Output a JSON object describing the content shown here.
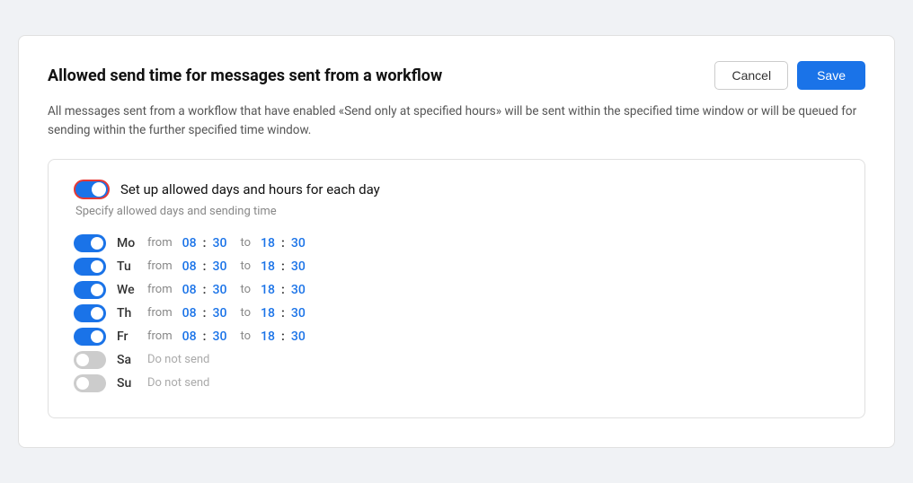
{
  "header": {
    "title": "Allowed send time for messages sent from a workflow",
    "cancel_label": "Cancel",
    "save_label": "Save"
  },
  "description": "All messages sent from a workflow that have enabled «Send only at specified hours» will be sent within the specified time window or will be queued for sending within the further specified time window.",
  "card": {
    "main_toggle_label": "Set up allowed days and hours for each day",
    "sub_label": "Specify allowed days and sending time",
    "days": [
      {
        "name": "Mo",
        "enabled": true,
        "from_h": "08",
        "from_m": "30",
        "to_h": "18",
        "to_m": "30"
      },
      {
        "name": "Tu",
        "enabled": true,
        "from_h": "08",
        "from_m": "30",
        "to_h": "18",
        "to_m": "30"
      },
      {
        "name": "We",
        "enabled": true,
        "from_h": "08",
        "from_m": "30",
        "to_h": "18",
        "to_m": "30"
      },
      {
        "name": "Th",
        "enabled": true,
        "from_h": "08",
        "from_m": "30",
        "to_h": "18",
        "to_m": "30"
      },
      {
        "name": "Fr",
        "enabled": true,
        "from_h": "08",
        "from_m": "30",
        "to_h": "18",
        "to_m": "30"
      },
      {
        "name": "Sa",
        "enabled": false,
        "do_not_send": "Do not send"
      },
      {
        "name": "Su",
        "enabled": false,
        "do_not_send": "Do not send"
      }
    ],
    "from_label": "from",
    "to_label": "to"
  }
}
